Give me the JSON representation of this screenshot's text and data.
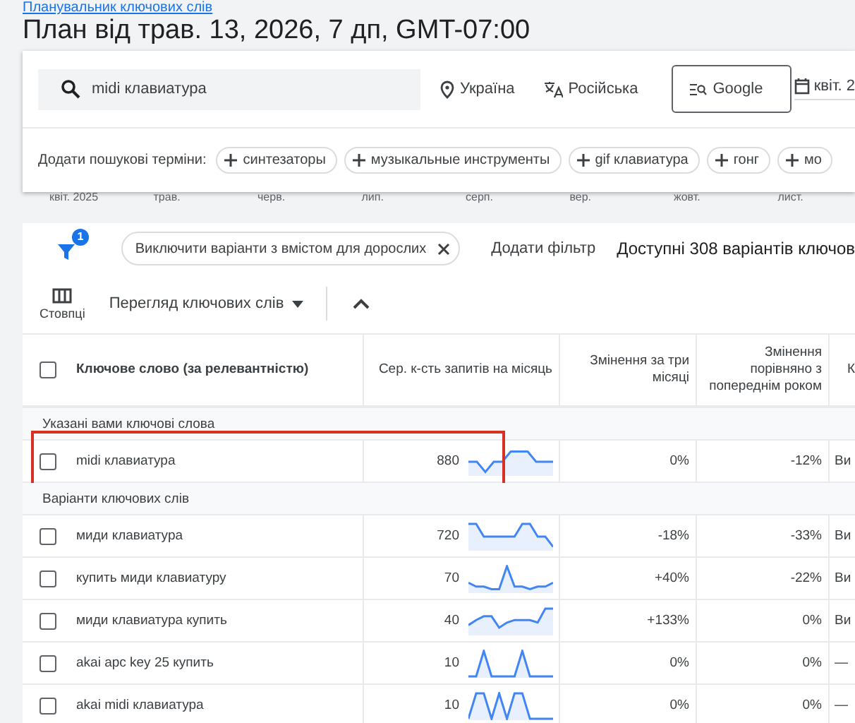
{
  "breadcrumb": "Планувальник ключових слів",
  "title": "План від трав. 13, 2026, 7 дп, GMT-07:00",
  "search": {
    "value": "midi клавиатура"
  },
  "location": "Україна",
  "language": "Російська",
  "network": "Google",
  "date_range": "квіт. 2",
  "add_terms": {
    "label": "Додати пошукові терміни:",
    "chips": [
      "синтезаторы",
      "музыкальные инструменты",
      "gif клавиатура",
      "гонг",
      "мо"
    ]
  },
  "timeline": [
    "квіт. 2025",
    "трав.",
    "черв.",
    "лип.",
    "серп.",
    "вер.",
    "жовт.",
    "лист."
  ],
  "filters": {
    "badge": "1",
    "chips": [
      "Виключити варіанти з вмістом для дорослих"
    ],
    "add_filter": "Додати фільтр",
    "summary": "Доступні 308 варіантів ключов"
  },
  "toolbar": {
    "columns_label": "Стовпці",
    "view": "Перегляд ключових слів"
  },
  "table": {
    "select_all_checked": false,
    "columns": [
      "Ключове слово (за релевантністю)",
      "Сер. к-сть запитів на місяць",
      "Змінення за три місяці",
      "Змінення порівняно з попереднім роком",
      "К"
    ],
    "groups": [
      {
        "label": "Указані вами ключові слова",
        "rows": [
          {
            "keyword": "midi клавиатура",
            "searches": "880",
            "three_month": "0%",
            "yoy": "-12%",
            "column_5": "Ви",
            "checked": false,
            "highlighted": true
          }
        ]
      },
      {
        "label": "Варіанти ключових слів",
        "rows": [
          {
            "keyword": "миди клавиатура",
            "searches": "720",
            "three_month": "-18%",
            "yoy": "-33%",
            "column_5": "Ви",
            "checked": false,
            "highlighted": false
          },
          {
            "keyword": "купить миди клавиатуру",
            "searches": "70",
            "three_month": "+40%",
            "yoy": "-22%",
            "column_5": "Ви",
            "checked": false,
            "highlighted": false
          },
          {
            "keyword": "миди клавиатура купить",
            "searches": "40",
            "three_month": "+133%",
            "yoy": "0%",
            "column_5": "Ви",
            "checked": false,
            "highlighted": false
          },
          {
            "keyword": "akai apc key 25 купить",
            "searches": "10",
            "three_month": "0%",
            "yoy": "0%",
            "column_5": "—",
            "checked": false,
            "highlighted": false
          },
          {
            "keyword": "akai midi клавиатура",
            "searches": "10",
            "three_month": "0%",
            "yoy": "0%",
            "column_5": "—",
            "checked": false,
            "highlighted": false
          }
        ]
      }
    ]
  }
}
